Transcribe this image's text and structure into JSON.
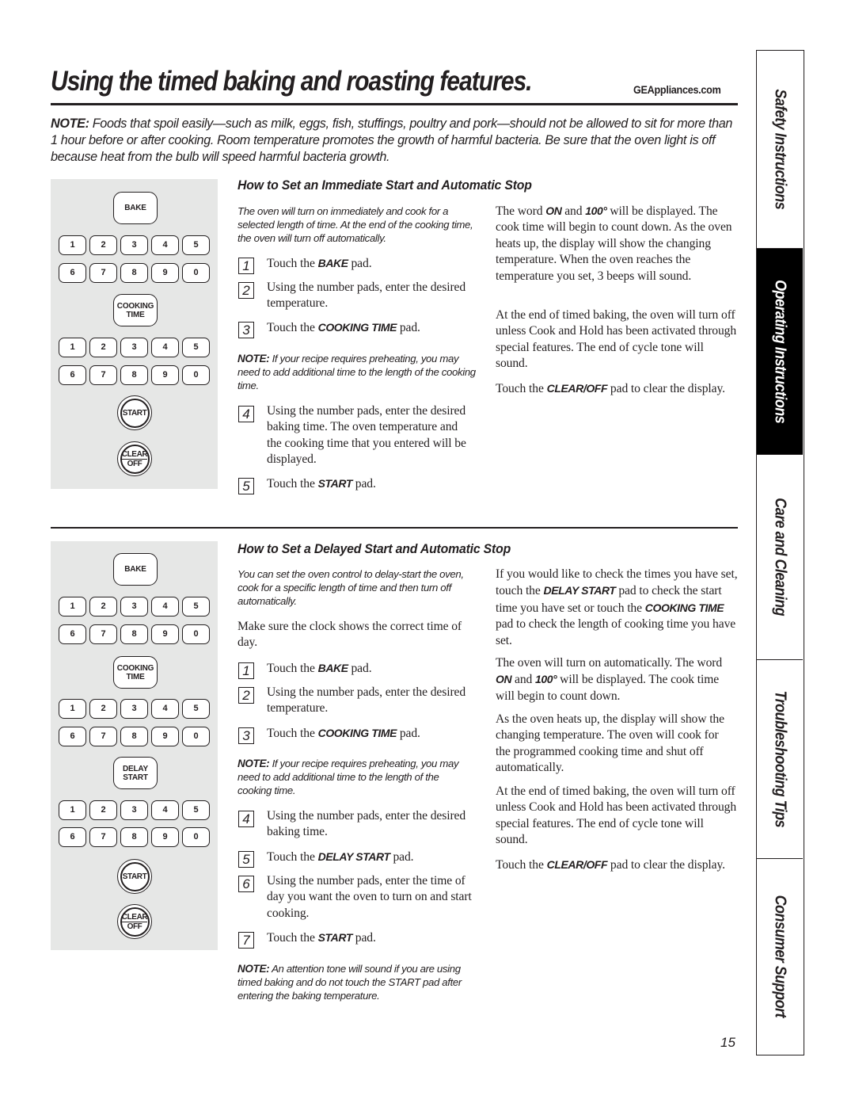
{
  "header": {
    "title": "Using the timed baking and roasting features.",
    "site": "GEAppliances.com"
  },
  "top_note": {
    "label": "NOTE:",
    "text": " Foods that spoil easily—such as milk, eggs, fish, stuffings, poultry and pork—should not be allowed to sit for more than 1 hour before or after cooking. Room temperature promotes the growth of harmful bacteria. Be sure that the oven light is off because heat from the bulb will speed harmful bacteria growth."
  },
  "keypad1": {
    "bake": "BAKE",
    "digits_row1": [
      "1",
      "2",
      "3",
      "4",
      "5"
    ],
    "digits_row2": [
      "6",
      "7",
      "8",
      "9",
      "0"
    ],
    "cooking_time": [
      "COOKING",
      "TIME"
    ],
    "start": "START",
    "clear": "CLEAR",
    "off": "OFF"
  },
  "keypad2": {
    "bake": "BAKE",
    "digits_row1": [
      "1",
      "2",
      "3",
      "4",
      "5"
    ],
    "digits_row2": [
      "6",
      "7",
      "8",
      "9",
      "0"
    ],
    "cooking_time": [
      "COOKING",
      "TIME"
    ],
    "delay_start": [
      "DELAY",
      "START"
    ],
    "start": "START",
    "clear": "CLEAR",
    "off": "OFF"
  },
  "section1": {
    "heading": "How to Set an Immediate Start and Automatic Stop",
    "intro": "The oven will turn on immediately and cook for a selected length of time. At the end of the cooking time, the oven will turn off automatically.",
    "steps": [
      {
        "num": "1",
        "pre": "Touch the ",
        "bold": "BAKE",
        "post": " pad."
      },
      {
        "num": "2",
        "pre": "Using the number pads, enter the desired temperature.",
        "bold": "",
        "post": ""
      },
      {
        "num": "3",
        "pre": "Touch the ",
        "bold": "COOKING TIME",
        "post": " pad."
      },
      {
        "num": "4",
        "pre": "Using the number pads, enter the desired baking time. The oven temperature and the cooking time that you entered will be displayed.",
        "bold": "",
        "post": ""
      },
      {
        "num": "5",
        "pre": "Touch the ",
        "bold": "START",
        "post": " pad."
      }
    ],
    "note": {
      "label": "NOTE:",
      "text": " If your recipe requires preheating, you may need to add additional time to the length of the cooking time."
    },
    "right": {
      "p1": {
        "a": "The word ",
        "b1": "ON",
        "c": " and ",
        "b2": "100°",
        "d": " will be displayed. The cook time will begin to count down. As the oven heats up, the display will show the changing temperature. When the oven reaches the temperature you set, 3 beeps will sound."
      },
      "p2": "At the end of timed baking, the oven will turn off unless Cook and Hold has been activated through special features. The end of cycle tone will sound.",
      "p3": {
        "a": "Touch the ",
        "b": "CLEAR/OFF",
        "c": " pad to clear the display."
      }
    }
  },
  "section2": {
    "heading": "How to Set a Delayed Start and Automatic Stop",
    "intro": "You can set the oven control to delay-start the oven, cook for a specific length of time and then turn off automatically.",
    "pre_step": "Make sure the clock shows the correct time of day.",
    "steps": [
      {
        "num": "1",
        "pre": "Touch the ",
        "bold": "BAKE",
        "post": " pad."
      },
      {
        "num": "2",
        "pre": "Using the number pads, enter the desired temperature.",
        "bold": "",
        "post": ""
      },
      {
        "num": "3",
        "pre": "Touch the ",
        "bold": "COOKING TIME",
        "post": " pad."
      },
      {
        "num": "4",
        "pre": "Using the number pads, enter the desired baking time.",
        "bold": "",
        "post": ""
      },
      {
        "num": "5",
        "pre": "Touch the ",
        "bold": "DELAY START",
        "post": " pad."
      },
      {
        "num": "6",
        "pre": "Using the number pads, enter the time of day you want the oven to turn on and start cooking.",
        "bold": "",
        "post": ""
      },
      {
        "num": "7",
        "pre": "Touch the ",
        "bold": "START",
        "post": " pad."
      }
    ],
    "note1": {
      "label": "NOTE:",
      "text": " If your recipe requires preheating, you may need to add additional time to the length of the cooking time."
    },
    "note2": {
      "label": "NOTE:",
      "text": " An attention tone will sound if you are using timed baking and do not touch the START pad after entering the baking temperature."
    },
    "right": {
      "p1": {
        "a": "If you would like to check the times you have set, touch the ",
        "b1": "DELAY START",
        "c": " pad to check the start time you have set or touch the ",
        "b2": "COOKING TIME",
        "d": " pad to check the length of cooking time you have set."
      },
      "p2": {
        "a": "The oven will turn on automatically. The word ",
        "b1": "ON",
        "c": " and ",
        "b2": "100°",
        "d": " will be displayed. The cook time will begin to count down."
      },
      "p3": "As the oven heats up, the display will show the changing temperature. The oven will cook for the programmed cooking time and shut off automatically.",
      "p4": "At the end of timed baking, the oven will turn off unless Cook and Hold has been activated through special features. The end of cycle tone will sound.",
      "p5": {
        "a": "Touch the ",
        "b": "CLEAR/OFF",
        "c": " pad to clear the display."
      }
    }
  },
  "sidebar": {
    "tabs": [
      {
        "label": "Safety Instructions",
        "active": false
      },
      {
        "label": "Operating Instructions",
        "active": true
      },
      {
        "label": "Care and Cleaning",
        "active": false
      },
      {
        "label": "Troubleshooting Tips",
        "active": false
      },
      {
        "label": "Consumer Support",
        "active": false
      }
    ]
  },
  "footer": {
    "page_number": "15"
  }
}
